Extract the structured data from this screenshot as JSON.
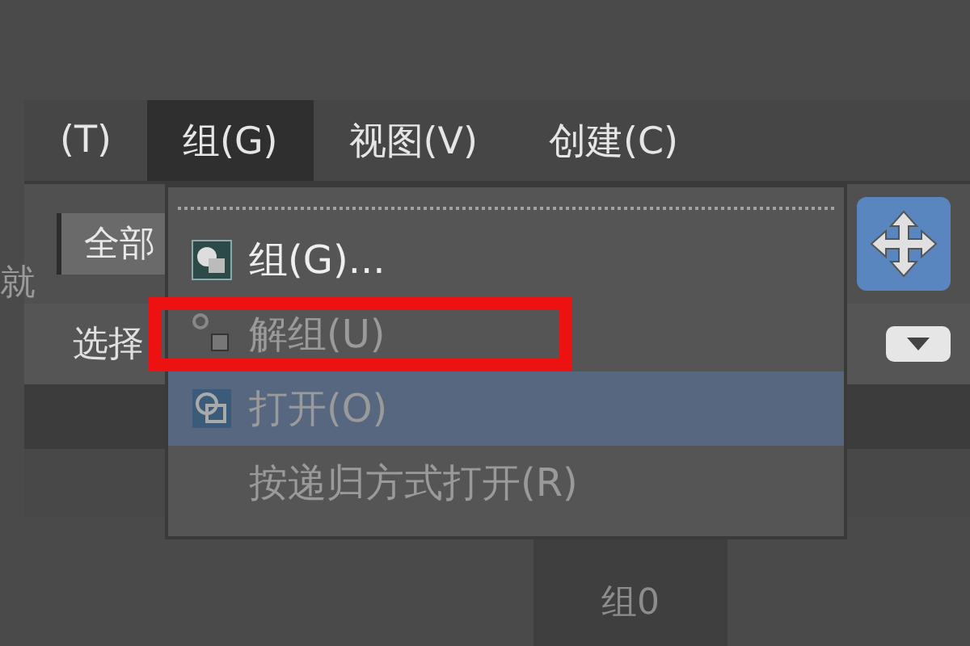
{
  "menu_bar": [
    {
      "label": "(T)",
      "selected": false
    },
    {
      "label": "组(G)",
      "selected": true
    },
    {
      "label": "视图(V)",
      "selected": false
    },
    {
      "label": "创建(C)",
      "selected": false
    }
  ],
  "toolbar": {
    "filter": "全部",
    "side_label": "就",
    "select": "选择"
  },
  "dropdown": [
    {
      "label": "组(G)...",
      "kind": "group",
      "disabled": false,
      "selected": false,
      "marked": false
    },
    {
      "label": "解组(U)",
      "kind": "ungroup",
      "disabled": true,
      "selected": false,
      "marked": true
    },
    {
      "label": "打开(O)",
      "kind": "open",
      "disabled": true,
      "selected": true,
      "marked": false
    },
    {
      "label": "按递归方式打开(R)",
      "kind": "plain",
      "disabled": true,
      "selected": false,
      "marked": false
    }
  ],
  "viewport": {
    "label": "组0"
  }
}
